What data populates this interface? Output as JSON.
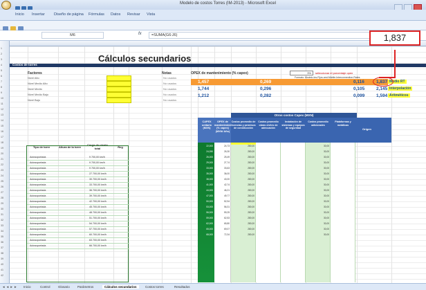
{
  "window": {
    "title": "Modelo de costos Torres (IM-2013) - Microsoft Excel"
  },
  "ribbon": {
    "tabs": [
      "Inicio",
      "Insertar",
      "Diseño de página",
      "Fórmulas",
      "Datos",
      "Revisar",
      "Vista"
    ]
  },
  "formula_bar": {
    "name_box": "M6",
    "fx": "fx",
    "formula": "=SUMA(G6:J6)"
  },
  "sheet": {
    "title": "Cálculos secundarios",
    "section": "Costos de torres",
    "factores_label": "Factores",
    "factores": [
      "Nivel Alto",
      "Nivel Medio Alto",
      "Nivel Medio",
      "Nivel Medio Bajo",
      "Nivel Bajo"
    ],
    "notas_label": "Notas",
    "notas": [
      "No usados",
      "No usados",
      "No usados",
      "No usados",
      "No usados"
    ],
    "opex_label": "OPEX de mantenimiento (% capex)",
    "dropdown_value": "3%",
    "dropdown_note": "seleccionar el porcentaje open",
    "formato_note": "Formato: Modelo-los-Fijos-and-Mobile-Interconnection-Rates",
    "results": [
      {
        "a": "1,457",
        "b": "0,269",
        "c": "0,116",
        "d": "1,837",
        "label": "Medio RT"
      },
      {
        "a": "1,744",
        "b": "0,296",
        "c": "0,105",
        "d": "2,145",
        "label": "Interpolación"
      },
      {
        "a": "1,212",
        "b": "0,282",
        "c": "0,099",
        "d": "1,594",
        "label": "Aritméticos"
      }
    ],
    "left_headers": {
      "tipo": "Tipo de torre",
      "altura": "Altura de la torre",
      "carga": "Carga de viento total",
      "reg": "Reg"
    },
    "capex_header": "CAPEX unitario (MXN)",
    "opex_col_header": "OPEX de mantenimiento (% capex) (MXN/ Año)",
    "otros_header": "Otros costos Capex (MXN)",
    "otros_cols": [
      "Costos promedio de licencias y permisos de construcción",
      "Costos promedio obras civiles de adecuación",
      "Instalación de sistemas y equipos de seguridad",
      "Costos promedio adicionales",
      "Plataformas y metálicas"
    ],
    "origen_header": "Origen",
    "rows": [
      {
        "tipo": "Autosoportada",
        "altura": "",
        "carga": "9 700,00 km/h",
        "capex": "22,000",
        "opex": "24,73",
        "lic": "280,00",
        "obras": "",
        "adic": "30,00"
      },
      {
        "tipo": "Autosoportada",
        "altura": "",
        "carga": "9 700,00 km/h",
        "capex": "24,050",
        "opex": "26,30",
        "lic": "280,00",
        "obras": "",
        "adic": "30,00"
      },
      {
        "tipo": "Autosoportada",
        "altura": "",
        "carga": "9 700,00 km/h",
        "capex": "26,000",
        "opex": "25,49",
        "lic": "280,00",
        "obras": "",
        "adic": "30,00"
      },
      {
        "tipo": "Autosoportada",
        "altura": "",
        "carga": "27 700,00 km/h",
        "capex": "29,000",
        "opex": "27,74",
        "lic": "280,00",
        "obras": "",
        "adic": "30,00"
      },
      {
        "tipo": "Autosoportada",
        "altura": "",
        "carga": "30 700,00 km/h",
        "capex": "33,000",
        "opex": "33,63",
        "lic": "280,00",
        "obras": "",
        "adic": "30,00"
      },
      {
        "tipo": "Autosoportada",
        "altura": "",
        "carga": "33 700,00 km/h",
        "capex": "35,000",
        "opex": "36,00",
        "lic": "280,00",
        "obras": "",
        "adic": "30,00"
      },
      {
        "tipo": "Autosoportada",
        "altura": "",
        "carga": "36 700,00 km/h",
        "capex": "38,000",
        "opex": "40,00",
        "lic": "280,00",
        "obras": "",
        "adic": "30,00"
      },
      {
        "tipo": "Autosoportada",
        "altura": "",
        "carga": "39 700,00 km/h",
        "capex": "41,000",
        "opex": "42,74",
        "lic": "280,00",
        "obras": "",
        "adic": "30,00"
      },
      {
        "tipo": "Autosoportada",
        "altura": "",
        "carga": "42 700,00 km/h",
        "capex": "44,000",
        "opex": "46,21",
        "lic": "280,00",
        "obras": "",
        "adic": "30,00"
      },
      {
        "tipo": "Autosoportada",
        "altura": "",
        "carga": "45 700,00 km/h",
        "capex": "47,000",
        "opex": "49,77",
        "lic": "280,00",
        "obras": "",
        "adic": "30,00"
      },
      {
        "tipo": "Autosoportada",
        "altura": "",
        "carga": "48 700,00 km/h",
        "capex": "50,000",
        "opex": "52,94",
        "lic": "280,00",
        "obras": "",
        "adic": "30,00"
      },
      {
        "tipo": "Autosoportada",
        "altura": "",
        "carga": "51 700,00 km/h",
        "capex": "53,000",
        "opex": "56,31",
        "lic": "280,00",
        "obras": "",
        "adic": "30,00"
      },
      {
        "tipo": "Autosoportada",
        "altura": "",
        "carga": "54 700,00 km/h",
        "capex": "56,000",
        "opex": "59,25",
        "lic": "280,00",
        "obras": "",
        "adic": "30,00"
      },
      {
        "tipo": "Autosoportada",
        "altura": "",
        "carga": "57 700,00 km/h",
        "capex": "59,000",
        "opex": "62,53",
        "lic": "280,00",
        "obras": "",
        "adic": "30,00"
      },
      {
        "tipo": "Autosoportada",
        "altura": "",
        "carga": "60 700,00 km/h",
        "capex": "62,000",
        "opex": "65,80",
        "lic": "280,00",
        "obras": "",
        "adic": "30,00"
      },
      {
        "tipo": "Autosoportada",
        "altura": "",
        "carga": "63 700,00 km/h",
        "capex": "65,000",
        "opex": "69,07",
        "lic": "280,00",
        "obras": "",
        "adic": "30,00"
      },
      {
        "tipo": "Autosoportada",
        "altura": "",
        "carga": "66 700,00 km/h",
        "capex": "68,000",
        "opex": "72,34",
        "lic": "280,00",
        "obras": "",
        "adic": "30,00"
      }
    ]
  },
  "callout": {
    "value": "1,837"
  },
  "sheet_tabs": {
    "nav": "◄ ◄ ► ►",
    "tabs": [
      "Inicio",
      "Control",
      "Glosario",
      "Parámetros",
      "Cálculos secundarios",
      "Costos torres",
      "Resultados"
    ],
    "active": "Cálculos secundarios"
  }
}
